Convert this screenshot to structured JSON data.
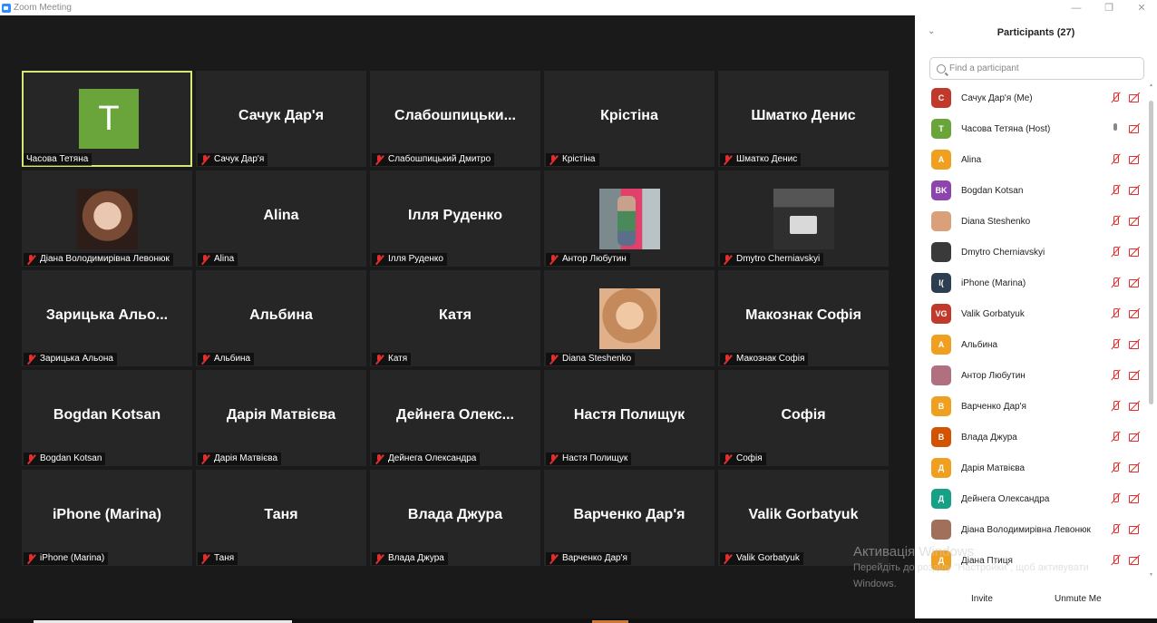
{
  "window": {
    "title": "Zoom Meeting",
    "minimize": "—",
    "maximize": "❐",
    "close": "✕"
  },
  "tiles": [
    {
      "display": "",
      "label": "Часова Тетяна",
      "muted": false,
      "active": true,
      "avatar_letter": "T",
      "avatar_color": "#6aa53b"
    },
    {
      "display": "Сачук Дар'я",
      "label": "Сачук Дар'я",
      "muted": true
    },
    {
      "display": "Слабошпицьки...",
      "label": "Слабошпицький Дмитро",
      "muted": true
    },
    {
      "display": "Крістіна",
      "label": "Крістіна",
      "muted": true
    },
    {
      "display": "Шматко Денис",
      "label": "Шматко Денис",
      "muted": true
    },
    {
      "display": "",
      "label": "Діана Володимирівна Левонюк",
      "muted": true,
      "photo": "diana-l"
    },
    {
      "display": "Alina",
      "label": "Alina",
      "muted": true
    },
    {
      "display": "Ілля Руденко",
      "label": "Ілля Руденко",
      "muted": true
    },
    {
      "display": "",
      "label": "Антор Любутин",
      "muted": true,
      "photo": "antor"
    },
    {
      "display": "",
      "label": "Dmytro Cherniavskyi",
      "muted": true,
      "photo": "dmytro"
    },
    {
      "display": "Зарицька Альо...",
      "label": "Зарицька Альона",
      "muted": true
    },
    {
      "display": "Альбина",
      "label": "Альбина",
      "muted": true
    },
    {
      "display": "Катя",
      "label": "Катя",
      "muted": true
    },
    {
      "display": "",
      "label": "Diana Steshenko",
      "muted": true,
      "photo": "diana-s"
    },
    {
      "display": "Макознак Софія",
      "label": "Макознак Софія",
      "muted": true
    },
    {
      "display": "Bogdan Kotsan",
      "label": "Bogdan Kotsan",
      "muted": true
    },
    {
      "display": "Дарія Матвієва",
      "label": "Дарія Матвієва",
      "muted": true
    },
    {
      "display": "Дейнега Олекс...",
      "label": "Дейнега Олександра",
      "muted": true
    },
    {
      "display": "Настя Полищук",
      "label": "Настя Полищук",
      "muted": true
    },
    {
      "display": "Софія",
      "label": "Софія",
      "muted": true
    },
    {
      "display": "iPhone (Marina)",
      "label": "iPhone (Marina)",
      "muted": true
    },
    {
      "display": "Таня",
      "label": "Таня",
      "muted": true
    },
    {
      "display": "Влада Джура",
      "label": "Влада Джура",
      "muted": true
    },
    {
      "display": "Варченко Дар'я",
      "label": "Варченко Дар'я",
      "muted": true
    },
    {
      "display": "Valik Gorbatyuk",
      "label": "Valik Gorbatyuk",
      "muted": true
    }
  ],
  "panel": {
    "title": "Participants (27)",
    "search_placeholder": "Find a participant",
    "invite": "Invite",
    "unmute_me": "Unmute Me",
    "participants": [
      {
        "name": "Сачук Дар'я (Me)",
        "initials": "C",
        "color": "#c0392b",
        "mic": "off"
      },
      {
        "name": "Часова Тетяна (Host)",
        "initials": "T",
        "color": "#6aa53b",
        "mic": "on"
      },
      {
        "name": "Alina",
        "initials": "A",
        "color": "#f0a020",
        "mic": "off"
      },
      {
        "name": "Bogdan Kotsan",
        "initials": "BK",
        "color": "#8e44ad",
        "mic": "off"
      },
      {
        "name": "Diana Steshenko",
        "initials": "",
        "color": "#d9a07a",
        "mic": "off"
      },
      {
        "name": "Dmytro Cherniavskyi",
        "initials": "",
        "color": "#3a3a3a",
        "mic": "off"
      },
      {
        "name": "iPhone (Marina)",
        "initials": "I(",
        "color": "#2c3e50",
        "mic": "off"
      },
      {
        "name": "Valik Gorbatyuk",
        "initials": "VG",
        "color": "#c0392b",
        "mic": "off"
      },
      {
        "name": "Альбина",
        "initials": "A",
        "color": "#f0a020",
        "mic": "off"
      },
      {
        "name": "Антор Любутин",
        "initials": "",
        "color": "#b07080",
        "mic": "off"
      },
      {
        "name": "Варченко Дар'я",
        "initials": "B",
        "color": "#f0a020",
        "mic": "off"
      },
      {
        "name": "Влада Джура",
        "initials": "B",
        "color": "#d35400",
        "mic": "off"
      },
      {
        "name": "Дарія Матвієва",
        "initials": "Д",
        "color": "#f0a020",
        "mic": "off"
      },
      {
        "name": "Дейнега Олександра",
        "initials": "Д",
        "color": "#16a085",
        "mic": "off"
      },
      {
        "name": "Діана Володимирівна Левонюк",
        "initials": "",
        "color": "#a0705a",
        "mic": "off"
      },
      {
        "name": "Діана Птиця",
        "initials": "Д",
        "color": "#f0a020",
        "mic": "off"
      }
    ]
  },
  "watermark": {
    "title": "Активація Windows",
    "line1": "Перейдіть до розділу \"Настройки\", щоб активувати",
    "line2": "Windows."
  }
}
